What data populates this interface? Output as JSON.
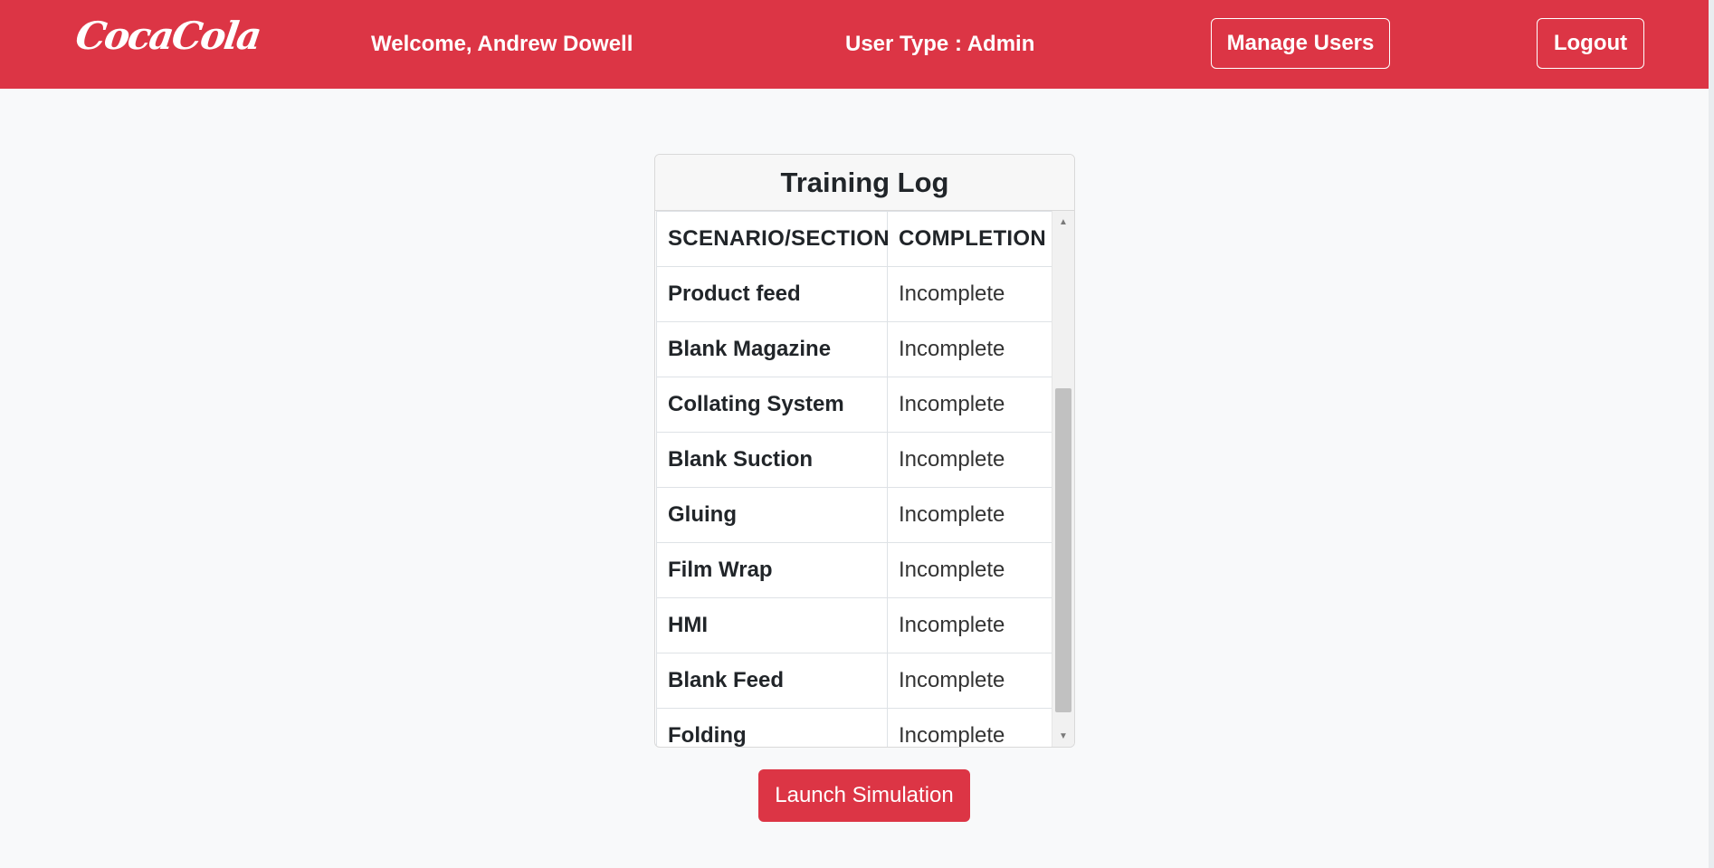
{
  "navbar": {
    "logo_text": "CocaCola",
    "welcome_text": "Welcome, Andrew Dowell",
    "user_type_text": "User Type : Admin",
    "manage_users_label": "Manage Users",
    "logout_label": "Logout"
  },
  "training_log": {
    "title": "Training Log",
    "columns": [
      "SCENARIO/SECTION",
      "COMPLETION"
    ],
    "rows": [
      {
        "section": "Product feed",
        "completion": "Incomplete"
      },
      {
        "section": "Blank Magazine",
        "completion": "Incomplete"
      },
      {
        "section": "Collating System",
        "completion": "Incomplete"
      },
      {
        "section": "Blank Suction",
        "completion": "Incomplete"
      },
      {
        "section": "Gluing",
        "completion": "Incomplete"
      },
      {
        "section": "Film Wrap",
        "completion": "Incomplete"
      },
      {
        "section": "HMI",
        "completion": "Incomplete"
      },
      {
        "section": "Blank Feed",
        "completion": "Incomplete"
      },
      {
        "section": "Folding",
        "completion": "Incomplete"
      }
    ]
  },
  "actions": {
    "launch_label": "Launch Simulation"
  },
  "icons": {
    "scroll_up": "scroll-up-arrow-icon",
    "scroll_down": "scroll-down-arrow-icon"
  },
  "colors": {
    "brand": "#dc3545",
    "background": "#f8f9fa"
  }
}
